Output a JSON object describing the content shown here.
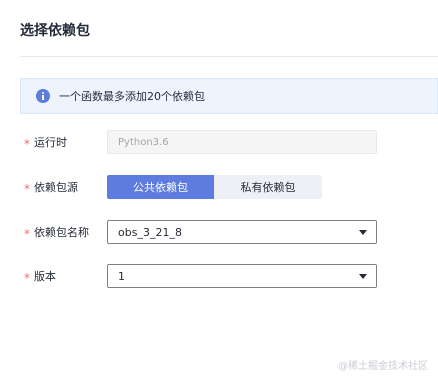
{
  "dialog": {
    "title": "选择依赖包"
  },
  "info": {
    "text": "一个函数最多添加20个依赖包",
    "icon": "info-icon"
  },
  "form": {
    "required_mark": "*",
    "runtime": {
      "label": "运行时",
      "value": "Python3.6"
    },
    "source": {
      "label": "依赖包源",
      "options": [
        "公共依赖包",
        "私有依赖包"
      ],
      "selected": "公共依赖包"
    },
    "package_name": {
      "label": "依赖包名称",
      "value": "obs_3_21_8"
    },
    "version": {
      "label": "版本",
      "value": "1"
    }
  },
  "watermark": "@稀土掘金技术社区",
  "colors": {
    "accent": "#5e7ce0",
    "required": "#f66f6a",
    "info_bg": "#eef4fe"
  }
}
